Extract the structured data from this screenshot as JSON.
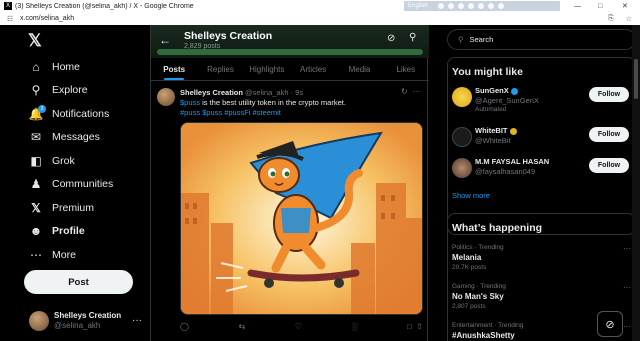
{
  "window": {
    "title": "(3) Shelleys Creation (@selina_akh) / X - Google Chrome",
    "ext_lang": "English"
  },
  "address": {
    "url": "x.com/selina_akh"
  },
  "nav": {
    "items": [
      {
        "label": "Home",
        "icon": "home-icon"
      },
      {
        "label": "Explore",
        "icon": "search-icon"
      },
      {
        "label": "Notifications",
        "icon": "bell-icon",
        "badge": "3"
      },
      {
        "label": "Messages",
        "icon": "mail-icon"
      },
      {
        "label": "Grok",
        "icon": "grok-icon"
      },
      {
        "label": "Communities",
        "icon": "people-icon"
      },
      {
        "label": "Premium",
        "icon": "x-icon"
      },
      {
        "label": "Profile",
        "icon": "person-icon"
      },
      {
        "label": "More",
        "icon": "more-circle-icon"
      }
    ],
    "post_label": "Post",
    "account": {
      "name": "Shelleys Creation",
      "handle": "@selina_akh",
      "more": "···"
    }
  },
  "profile": {
    "title": "Shelleys Creation",
    "subtitle": "2,829 posts",
    "tabs": [
      "Posts",
      "Replies",
      "Highlights",
      "Articles",
      "Media",
      "Likes"
    ],
    "active_tab": "Posts"
  },
  "tweet": {
    "name": "Shelleys Creation",
    "handle_time": "@selina_akh · 9s",
    "text_link1": "$puss",
    "text_rest": " is the best utility token in the crypto market.",
    "hashtags": "#puss $puss #pussFi #steemit"
  },
  "sidebar": {
    "search_placeholder": "Search",
    "might_like_title": "You might like",
    "suggestions": [
      {
        "name": "SunGenX",
        "handle": "@Agent_SunGenX",
        "extra": "Automated",
        "button": "Follow",
        "badge": "blue"
      },
      {
        "name": "WhiteBIT",
        "handle": "@WhiteBit",
        "extra": "",
        "button": "Follow",
        "badge": "gold"
      },
      {
        "name": "M.M FAYSAL HASAN",
        "handle": "@faysalhasan049",
        "extra": "",
        "button": "Follow",
        "badge": ""
      }
    ],
    "show_more": "Show more",
    "happening_title": "What’s happening",
    "trends": [
      {
        "category": "Politics · Trending",
        "name": "Melania",
        "posts": "20.7K posts"
      },
      {
        "category": "Gaming · Trending",
        "name": "No Man's Sky",
        "posts": "2,807 posts"
      },
      {
        "category": "Entertainment · Trending",
        "name": "#AnushkaShetty",
        "posts": ""
      }
    ]
  },
  "colors": {
    "accent": "#1d9bf0",
    "bg": "#000000",
    "border": "#2f3336"
  }
}
